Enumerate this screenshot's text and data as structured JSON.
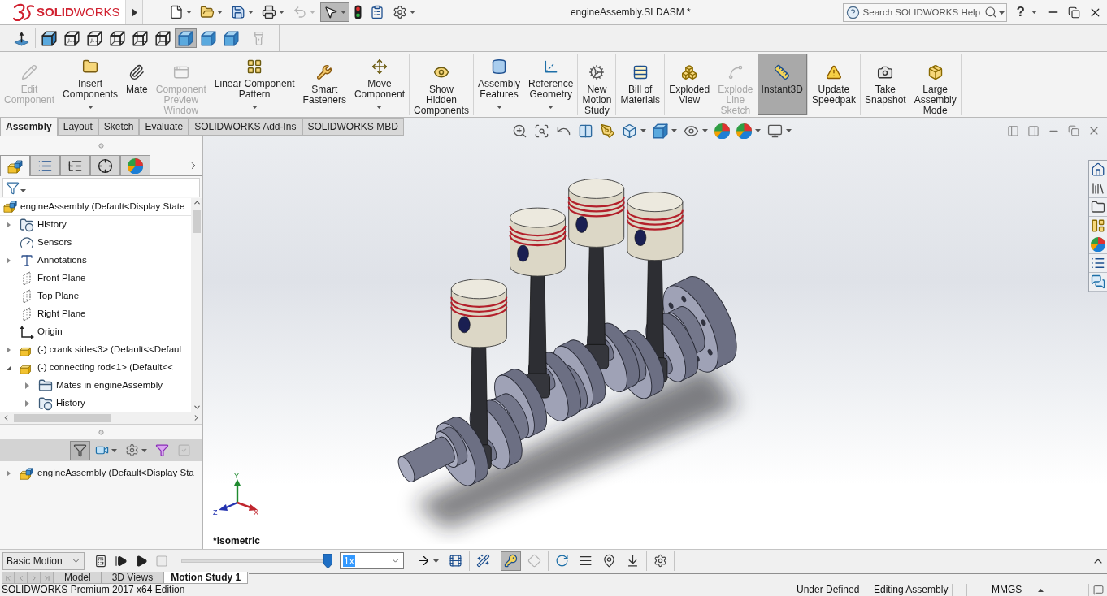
{
  "title_bar": {
    "logo": "**SOLID**WORKS",
    "quick_access": [
      {
        "kind": "new",
        "dropdown": true,
        "disabled": false,
        "selected": false
      },
      {
        "kind": "open",
        "dropdown": true,
        "disabled": false,
        "selected": false
      },
      {
        "kind": "save",
        "dropdown": true,
        "disabled": false,
        "selected": false
      },
      {
        "kind": "print",
        "dropdown": true,
        "disabled": false,
        "selected": false
      },
      {
        "kind": "undo",
        "dropdown": true,
        "disabled": true,
        "selected": false
      },
      {
        "kind": "select",
        "dropdown": true,
        "disabled": false,
        "selected": true
      },
      {
        "kind": "rebuild",
        "dropdown": false,
        "disabled": false,
        "selected": false
      },
      {
        "kind": "file_properties",
        "dropdown": false,
        "disabled": false,
        "selected": false
      },
      {
        "kind": "options",
        "dropdown": true,
        "disabled": false,
        "selected": false
      }
    ],
    "document_title": "engineAssembly.SLDASM *",
    "search": {
      "placeholder": "Search SOLIDWORKS Help"
    },
    "help": "?"
  },
  "view_toolbar": [
    {
      "tools": [
        {
          "kind": "normal_to",
          "selected": false,
          "disabled": false
        }
      ]
    },
    {
      "tools": [
        {
          "kind": "cube_shaded_edges",
          "selected": false,
          "disabled": false
        },
        {
          "kind": "cube_hidden_dashed",
          "selected": false,
          "disabled": false
        },
        {
          "kind": "cube_hidden_dashed",
          "selected": false,
          "disabled": false
        },
        {
          "kind": "cube_wireframe",
          "selected": false,
          "disabled": false
        },
        {
          "kind": "cube_wireframe",
          "selected": false,
          "disabled": false
        },
        {
          "kind": "cube_wireframe",
          "selected": false,
          "disabled": false
        },
        {
          "kind": "cube_shaded",
          "selected": true,
          "disabled": false
        },
        {
          "kind": "cube_shaded",
          "selected": false,
          "disabled": false
        },
        {
          "kind": "cube_shaded",
          "selected": false,
          "disabled": false
        }
      ]
    },
    {
      "tools": [
        {
          "kind": "flashlight",
          "selected": false,
          "disabled": true
        }
      ]
    }
  ],
  "ribbon": {
    "groups": [
      {
        "buttons": [
          {
            "kind": "edit_component",
            "label": "Edit\nComponent",
            "dropdown": false,
            "disabled": true,
            "selected": false
          },
          {
            "kind": "insert_components",
            "label": "Insert\nComponents",
            "dropdown": true,
            "disabled": false,
            "selected": false
          },
          {
            "kind": "mate",
            "label": "Mate",
            "dropdown": false,
            "disabled": false,
            "selected": false
          },
          {
            "kind": "component_preview",
            "label": "Component\nPreview\nWindow",
            "dropdown": false,
            "disabled": true,
            "selected": false
          },
          {
            "kind": "linear_pattern",
            "label": "Linear Component\nPattern",
            "dropdown": true,
            "disabled": false,
            "selected": false
          },
          {
            "kind": "smart_fasteners",
            "label": "Smart\nFasteners",
            "dropdown": false,
            "disabled": false,
            "selected": false
          },
          {
            "kind": "move_component",
            "label": "Move\nComponent",
            "dropdown": true,
            "disabled": false,
            "selected": false
          }
        ]
      },
      {
        "buttons": [
          {
            "kind": "show_hidden",
            "label": "Show\nHidden\nComponents",
            "dropdown": false,
            "disabled": false,
            "selected": false
          }
        ]
      },
      {
        "buttons": [
          {
            "kind": "assembly_features",
            "label": "Assembly\nFeatures",
            "dropdown": true,
            "disabled": false,
            "selected": false
          },
          {
            "kind": "reference_geometry",
            "label": "Reference\nGeometry",
            "dropdown": true,
            "disabled": false,
            "selected": false
          }
        ]
      },
      {
        "buttons": [
          {
            "kind": "new_motion_study",
            "label": "New\nMotion\nStudy",
            "dropdown": false,
            "disabled": false,
            "selected": false
          }
        ]
      },
      {
        "buttons": [
          {
            "kind": "bill_of_materials",
            "label": "Bill of\nMaterials",
            "dropdown": false,
            "disabled": false,
            "selected": false
          }
        ]
      },
      {
        "buttons": [
          {
            "kind": "exploded_view",
            "label": "Exploded\nView",
            "dropdown": false,
            "disabled": false,
            "selected": false
          },
          {
            "kind": "explode_line_sketch",
            "label": "Explode\nLine\nSketch",
            "dropdown": false,
            "disabled": true,
            "selected": false
          },
          {
            "kind": "instant3d",
            "label": "Instant3D",
            "dropdown": false,
            "disabled": false,
            "selected": true
          }
        ]
      },
      {
        "buttons": [
          {
            "kind": "update_speedpak",
            "label": "Update\nSpeedpak",
            "dropdown": false,
            "disabled": false,
            "selected": false
          }
        ]
      },
      {
        "buttons": [
          {
            "kind": "take_snapshot",
            "label": "Take\nSnapshot",
            "dropdown": false,
            "disabled": false,
            "selected": false
          },
          {
            "kind": "large_assembly_mode",
            "label": "Large\nAssembly\nMode",
            "dropdown": false,
            "disabled": false,
            "selected": false
          }
        ]
      }
    ]
  },
  "command_tabs": [
    {
      "label": "Assembly",
      "selected": true
    },
    {
      "label": "Layout",
      "selected": false
    },
    {
      "label": "Sketch",
      "selected": false
    },
    {
      "label": "Evaluate",
      "selected": false
    },
    {
      "label": "SOLIDWORKS Add-Ins",
      "selected": false
    },
    {
      "label": "SOLIDWORKS MBD",
      "selected": false
    }
  ],
  "feature_manager": {
    "panel_tabs": [
      {
        "kind": "feature_tree",
        "selected": true
      },
      {
        "kind": "property_manager",
        "selected": false
      },
      {
        "kind": "configuration_manager",
        "selected": false
      },
      {
        "kind": "dimxpert",
        "selected": false
      },
      {
        "kind": "display_manager",
        "selected": false
      }
    ],
    "tree": {
      "label": "engineAssembly (Default<Display State",
      "kind": "assembly",
      "children": [
        {
          "label": "History",
          "kind": "history",
          "expanded": false
        },
        {
          "label": "Sensors",
          "kind": "sensors"
        },
        {
          "label": "Annotations",
          "kind": "annotations",
          "expanded": false
        },
        {
          "label": "Front Plane",
          "kind": "plane"
        },
        {
          "label": "Top Plane",
          "kind": "plane"
        },
        {
          "label": "Right Plane",
          "kind": "plane"
        },
        {
          "label": "Origin",
          "kind": "origin"
        },
        {
          "label": "(-) crank side<3> (Default<<Defaul",
          "kind": "part",
          "expanded": false
        },
        {
          "label": "(-) connecting rod<1> (Default<<",
          "kind": "part",
          "expanded": true,
          "children": [
            {
              "label": "Mates in engineAssembly",
              "kind": "mates",
              "expanded": false
            },
            {
              "label": "History",
              "kind": "history",
              "expanded": false
            }
          ]
        }
      ]
    },
    "bottom_toolbar": [
      {
        "kind": "filter",
        "dropdown": false,
        "selected": true,
        "disabled": false
      },
      {
        "kind": "camera_folder",
        "dropdown": true,
        "selected": false,
        "disabled": false
      },
      {
        "kind": "gear",
        "dropdown": true,
        "selected": false,
        "disabled": false
      },
      {
        "kind": "dynamic_filter",
        "dropdown": false,
        "selected": false,
        "disabled": false
      },
      {
        "kind": "check",
        "dropdown": false,
        "selected": false,
        "disabled": true
      }
    ],
    "bottom_tree": [
      {
        "label": "engineAssembly (Default<Display Sta",
        "kind": "assembly",
        "expanded": false
      }
    ]
  },
  "graphics": {
    "heads_up": [
      {
        "kind": "zoom_to_fit",
        "dropdown": false
      },
      {
        "kind": "zoom_area",
        "dropdown": false
      },
      {
        "kind": "previous_view",
        "dropdown": false
      },
      {
        "kind": "section_view",
        "dropdown": false
      },
      {
        "kind": "dynamic_annotation",
        "dropdown": false
      },
      {
        "kind": "view_orientation",
        "dropdown": true
      },
      {
        "kind": "display_style",
        "dropdown": true
      },
      {
        "kind": "hide_show",
        "dropdown": true
      },
      {
        "kind": "edit_appearance",
        "dropdown": false
      },
      {
        "kind": "apply_scene",
        "dropdown": true
      },
      {
        "kind": "view_settings",
        "dropdown": true
      }
    ],
    "triad": {
      "x": "X",
      "y": "Y",
      "z": "Z"
    },
    "view_name": "*Isometric"
  },
  "motion_manager": {
    "study_type": "Basic Motion",
    "playback_tools": [
      {
        "kind": "calculate",
        "disabled": false
      },
      {
        "kind": "play_from_start",
        "disabled": false
      },
      {
        "kind": "play",
        "disabled": false
      },
      {
        "kind": "stop",
        "disabled": true
      }
    ],
    "timeline": {
      "level": 1
    },
    "speed": {
      "value": "1x",
      "highlighted": true
    },
    "tool_groups": [
      {
        "tools": [
          {
            "kind": "playback_mode",
            "dropdown": true,
            "selected": false,
            "disabled": false
          },
          {
            "kind": "save_animation",
            "dropdown": false,
            "selected": false,
            "disabled": false
          }
        ]
      },
      {
        "tools": [
          {
            "kind": "animation_wizard",
            "dropdown": false,
            "selected": false,
            "disabled": false
          }
        ]
      },
      {
        "tools": [
          {
            "kind": "autokey",
            "dropdown": false,
            "selected": true,
            "disabled": false
          },
          {
            "kind": "add_key",
            "dropdown": false,
            "selected": false,
            "disabled": true
          }
        ]
      },
      {
        "tools": [
          {
            "kind": "motor",
            "dropdown": false,
            "selected": false,
            "disabled": false
          },
          {
            "kind": "spring",
            "dropdown": false,
            "selected": false,
            "disabled": false
          },
          {
            "kind": "contact",
            "dropdown": false,
            "selected": false,
            "disabled": false
          },
          {
            "kind": "gravity",
            "dropdown": false,
            "selected": false,
            "disabled": false
          }
        ]
      },
      {
        "tools": [
          {
            "kind": "study_properties",
            "dropdown": false,
            "selected": false,
            "disabled": false
          }
        ]
      }
    ],
    "tabs": [
      {
        "label": "Model",
        "selected": false
      },
      {
        "label": "3D Views",
        "selected": false
      },
      {
        "label": "Motion Study 1",
        "selected": true
      }
    ]
  },
  "status_bar": {
    "product": "SOLIDWORKS Premium 2017 x64 Edition",
    "fields": [
      "Under Defined",
      "Editing Assembly"
    ],
    "units": "MMGS"
  }
}
